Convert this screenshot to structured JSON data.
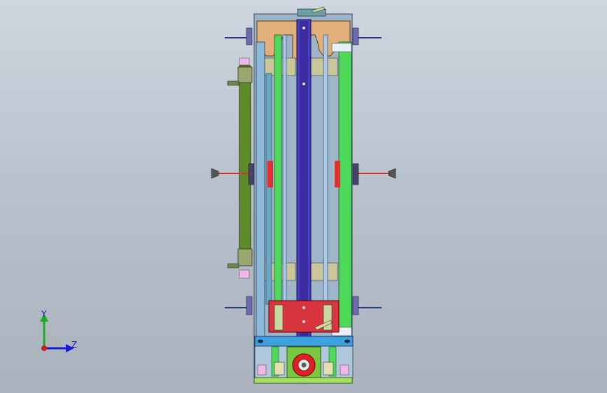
{
  "viewport": {
    "background_top": "#cfd6df",
    "background_bottom": "#a9b2bd"
  },
  "triad": {
    "y_label": "Y",
    "z_label": "Z",
    "y_color": "#19b019",
    "z_color": "#1a1ad0",
    "x_color": "#d01a1a"
  },
  "colors": {
    "frame_blue": "#8db8d8",
    "main_column": "#4a3cb8",
    "guide_green": "#4fd95a",
    "tan_plate": "#e2b07a",
    "olive_arm": "#5f8a2a",
    "red_block": "#d8353f",
    "base_green": "#a8e060",
    "cross_blue": "#3fa0e0"
  }
}
